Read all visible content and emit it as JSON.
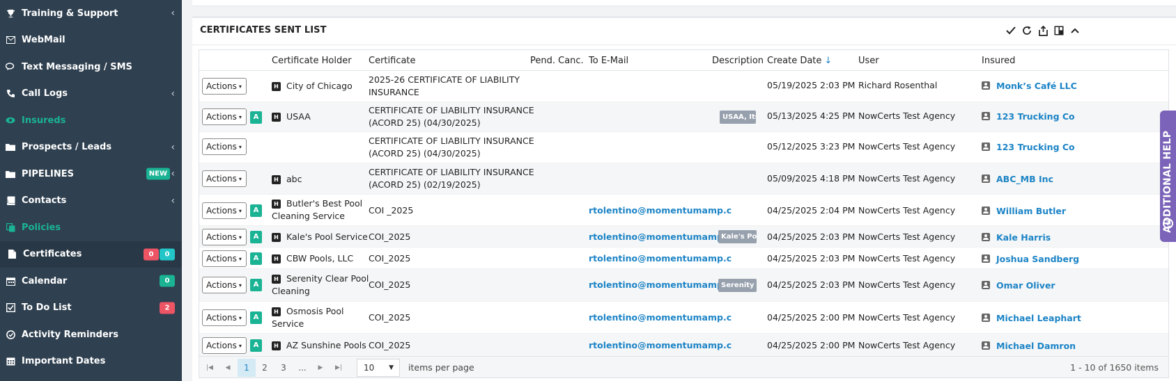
{
  "sidebar": {
    "items": [
      {
        "label": "Training & Support",
        "icon": "trophy-icon"
      },
      {
        "label": "WebMail",
        "icon": "envelope-icon"
      },
      {
        "label": "Text Messaging / SMS",
        "icon": "chat-icon"
      },
      {
        "label": "Call Logs",
        "icon": "phone-icon"
      },
      {
        "label": "Insureds",
        "icon": "eye-icon"
      },
      {
        "label": "Prospects / Leads",
        "icon": "folder-icon"
      },
      {
        "label": "PIPELINES",
        "icon": "folder-icon",
        "badge": "NEW"
      },
      {
        "label": "Contacts",
        "icon": "book-icon"
      },
      {
        "label": "Policies",
        "icon": "copy-icon"
      },
      {
        "label": "Certificates",
        "icon": "file-icon",
        "badge_red": "0",
        "badge_teal": "0"
      },
      {
        "label": "Calendar",
        "icon": "calendar-icon",
        "badge": "0"
      },
      {
        "label": "To Do List",
        "icon": "checkbox-icon",
        "badge": "2"
      },
      {
        "label": "Activity Reminders",
        "icon": "clock-icon"
      },
      {
        "label": "Important Dates",
        "icon": "calendar-grid-icon"
      }
    ]
  },
  "panel": {
    "title": "CERTIFICATES SENT LIST"
  },
  "table": {
    "headers": {
      "holder": "Certificate Holder",
      "certificate": "Certificate",
      "pend": "Pend. Canc.",
      "email": "To E-Mail",
      "description": "Description",
      "create_date": "Create Date",
      "user": "User",
      "insured": "Insured"
    },
    "action_label": "Actions",
    "rows": [
      {
        "a": "",
        "holder": "City of Chicago",
        "cert1": "2025-26 CERTIFICATE OF LIABILITY",
        "cert2": "INSURANCE",
        "email": "",
        "desc": "",
        "date": "05/19/2025 2:03 PM",
        "user": "Richard Rosenthal",
        "insured": "Monk’s Café LLC"
      },
      {
        "a": "A",
        "holder": "USAA",
        "cert1": "CERTIFICATE OF LIABILITY INSURANCE",
        "cert2": "(ACORD 25) (04/30/2025)",
        "email": "",
        "desc": "USAA, Its",
        "date": "05/13/2025 4:25 PM",
        "user": "NowCerts Test Agency",
        "insured": "123 Trucking Co"
      },
      {
        "a": "",
        "holder": "",
        "cert1": "CERTIFICATE OF LIABILITY INSURANCE",
        "cert2": "(ACORD 25) (04/30/2025)",
        "email": "",
        "desc": "",
        "date": "05/12/2025 3:23 PM",
        "user": "NowCerts Test Agency",
        "insured": "123 Trucking Co"
      },
      {
        "a": "",
        "holder": "abc",
        "cert1": "CERTIFICATE OF LIABILITY INSURANCE",
        "cert2": "(ACORD 25) (02/19/2025)",
        "email": "",
        "desc": "",
        "date": "05/09/2025 4:18 PM",
        "user": "NowCerts Test Agency",
        "insured": "ABC_MB Inc"
      },
      {
        "a": "A",
        "holder": "Butler's Best Pool",
        "holder2": "Cleaning Service",
        "cert1": "COI _2025",
        "cert2": "",
        "email": "rtolentino@momentumamp.c",
        "desc": "",
        "date": "04/25/2025 2:04 PM",
        "user": "NowCerts Test Agency",
        "insured": "William Butler"
      },
      {
        "a": "A",
        "holder": "Kale's Pool Service",
        "cert1": "COI_2025",
        "cert2": "",
        "email": "rtolentino@momentumamp.c",
        "desc": "Kale's Poo",
        "date": "04/25/2025 2:03 PM",
        "user": "NowCerts Test Agency",
        "insured": "Kale Harris"
      },
      {
        "a": "A",
        "holder": "CBW Pools, LLC",
        "cert1": "COI_2025",
        "cert2": "",
        "email": "rtolentino@momentumamp.c",
        "desc": "",
        "date": "04/25/2025 2:03 PM",
        "user": "NowCerts Test Agency",
        "insured": "Joshua Sandberg"
      },
      {
        "a": "A",
        "holder": "Serenity Clear Pool",
        "holder2": "Cleaning",
        "cert1": "COI_2025",
        "cert2": "",
        "email": "rtolentino@momentumamp.c",
        "desc": "Serenity C",
        "date": "04/25/2025 2:03 PM",
        "user": "NowCerts Test Agency",
        "insured": "Omar Oliver"
      },
      {
        "a": "A",
        "holder": "Osmosis Pool",
        "holder2": "Service",
        "cert1": "COI_2025",
        "cert2": "",
        "email": "rtolentino@momentumamp.c",
        "desc": "",
        "date": "04/25/2025 2:00 PM",
        "user": "NowCerts Test Agency",
        "insured": "Michael Leaphart"
      },
      {
        "a": "A",
        "holder": "AZ Sunshine Pools",
        "cert1": "COI_2025",
        "cert2": "",
        "email": "rtolentino@momentumamp.c",
        "desc": "",
        "date": "04/25/2025 2:00 PM",
        "user": "NowCerts Test Agency",
        "insured": "Michael Damron"
      }
    ]
  },
  "pager": {
    "pages": [
      "1",
      "2",
      "3",
      "..."
    ],
    "page_size": "10",
    "items_per_page": "items per page",
    "info": "1 - 10 of 1650 items"
  },
  "help_tab": {
    "label": "ADDITIONAL HELP"
  }
}
